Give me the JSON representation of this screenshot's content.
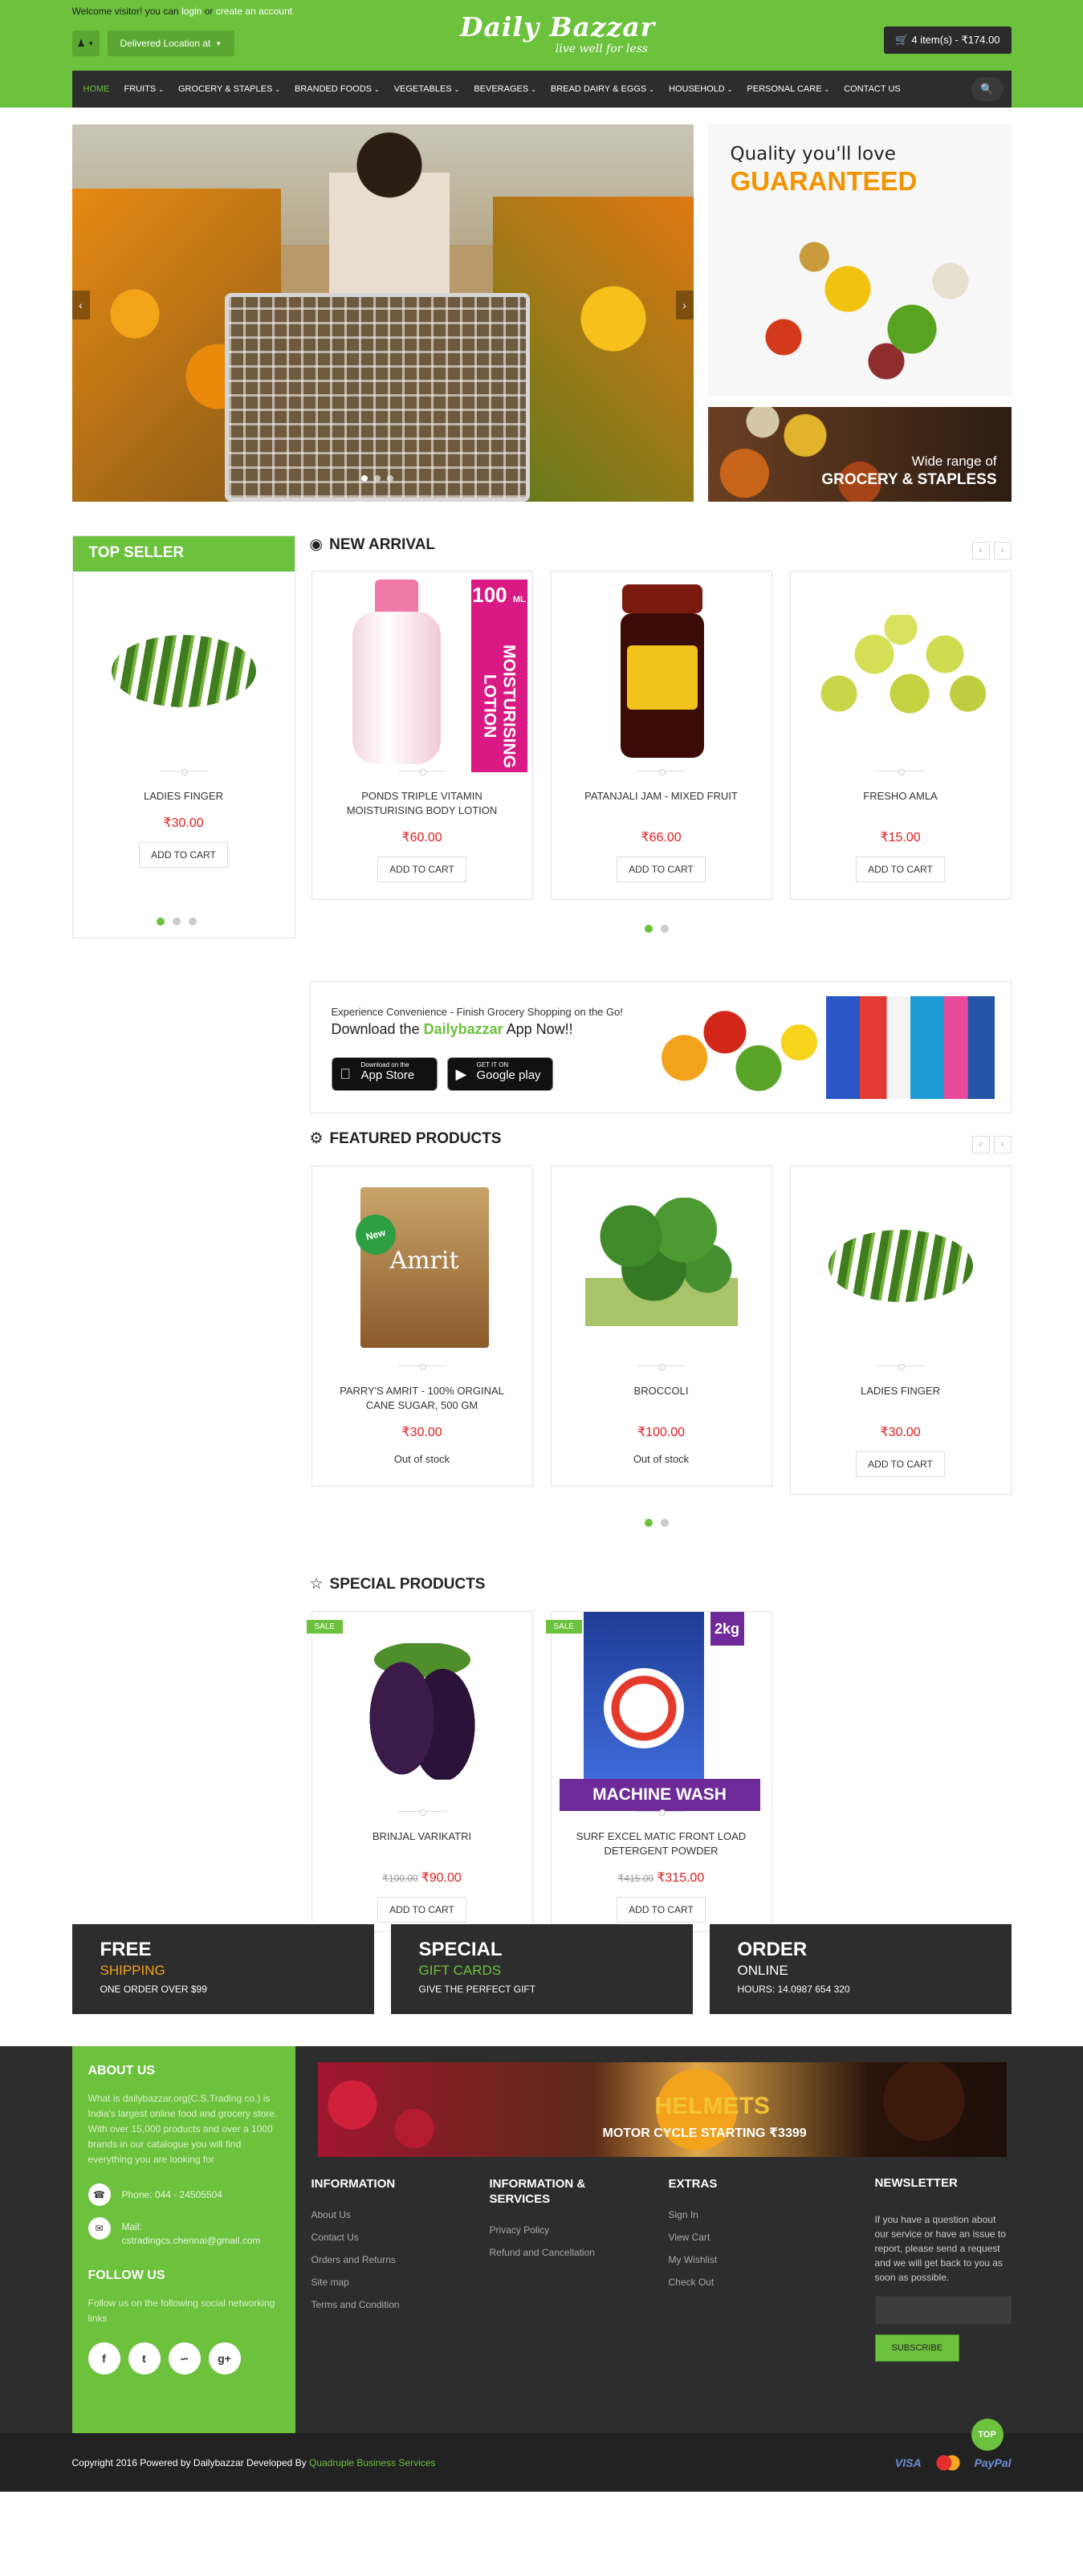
{
  "header": {
    "welcome_prefix": "Welcome visitor! you can ",
    "login": "login",
    "or": " or ",
    "create_account": "create an account",
    "location": "Delivered Location at",
    "logo_title": "Daily Bazzar",
    "logo_tagline": "live well for less",
    "cart": "4 item(s) - ₹174.00"
  },
  "nav": {
    "items": [
      {
        "label": "HOME"
      },
      {
        "label": "FRUITS"
      },
      {
        "label": "GROCERY & STAPLES"
      },
      {
        "label": "BRANDED FOODS"
      },
      {
        "label": "VEGETABLES"
      },
      {
        "label": "BEVERAGES"
      },
      {
        "label": "BREAD DAIRY & EGGS"
      },
      {
        "label": "HOUSEHOLD"
      },
      {
        "label": "PERSONAL CARE"
      },
      {
        "label": "CONTACT US"
      }
    ]
  },
  "banners": {
    "quality_line1": "Quality you'll love",
    "quality_line2": "GUARANTEED",
    "grocery_line1": "Wide range of",
    "grocery_line2": "GROCERY & STAPLESS"
  },
  "top_seller": {
    "title": "TOP SELLER",
    "product": {
      "name": "LADIES FINGER",
      "price": "₹30.00",
      "button": "ADD TO CART"
    }
  },
  "new_arrival": {
    "title": "NEW ARRIVAL",
    "products": [
      {
        "name": "PONDS TRIPLE VITAMIN MOISTURISING BODY LOTION",
        "price": "₹60.00",
        "button": "ADD TO CART",
        "img_num": "100",
        "img_unit": "ML",
        "img_text": "MOISTURISING LOTION"
      },
      {
        "name": "PATANJALI JAM - MIXED FRUIT",
        "price": "₹66.00",
        "button": "ADD TO CART"
      },
      {
        "name": "FRESHO AMLA",
        "price": "₹15.00",
        "button": "ADD TO CART"
      }
    ]
  },
  "app_banner": {
    "line1": "Experience Convenience - Finish Grocery Shopping on the Go!",
    "line2_pre": "Download the ",
    "line2_brand": "Dailybazzar",
    "line2_post": " App Now!!",
    "appstore_small": "Download on the",
    "appstore_big": "App Store",
    "gplay_small": "GET IT ON",
    "gplay_big": "Google play"
  },
  "featured": {
    "title": "FEATURED PRODUCTS",
    "products": [
      {
        "name": "PARRY'S AMRIT - 100% ORGINAL CANE SUGAR, 500 GM",
        "price": "₹30.00",
        "status": "Out of stock",
        "badge": "New",
        "img_text": "Amrit"
      },
      {
        "name": "BROCCOLI",
        "price": "₹100.00",
        "status": "Out of stock"
      },
      {
        "name": "LADIES FINGER",
        "price": "₹30.00",
        "button": "ADD TO CART"
      }
    ]
  },
  "special": {
    "title": "SPECIAL PRODUCTS",
    "products": [
      {
        "name": "BRINJAL VARIKATRI",
        "old_price": "₹100.00",
        "price": "₹90.00",
        "button": "ADD TO CART",
        "badge": "SALE"
      },
      {
        "name": "SURF EXCEL MATIC FRONT LOAD DETERGENT POWDER",
        "old_price": "₹415.00",
        "price": "₹315.00",
        "button": "ADD TO CART",
        "badge": "SALE",
        "img_kg": "2kg",
        "img_text": "MACHINE WASH"
      }
    ]
  },
  "features": [
    {
      "h": "FREE",
      "s": "SHIPPING",
      "d": "ONE ORDER OVER $99"
    },
    {
      "h": "SPECIAL",
      "s": "GIFT CARDS",
      "d": "GIVE THE PERFECT GIFT"
    },
    {
      "h": "ORDER",
      "s": "ONLINE",
      "d": "HOURS: 14.0987 654 320"
    }
  ],
  "footer": {
    "about_title": "ABOUT US",
    "about_text": "What is dailybazzar.org(C.S.Trading co.) is India's largest online food and grocery store. With over 15,000 products and over a 1000 brands in our catalogue you will find everything you are looking for",
    "phone": "Phone: 044 - 24505504",
    "mail": "Mail: cstradingcs.chennai@gmail.com",
    "follow_title": "FOLLOW US",
    "follow_text": "Follow us on the following social networking links",
    "banner_h": "HELMETS",
    "banner_m": "MOTOR CYCLE STARTING ₹3399",
    "col1_title": "INFORMATION",
    "col1": [
      {
        "label": "About Us"
      },
      {
        "label": "Contact Us"
      },
      {
        "label": "Orders and Returns"
      },
      {
        "label": "Site map"
      },
      {
        "label": "Terms and Condition"
      }
    ],
    "col2_title": "INFORMATION & SERVICES",
    "col2": [
      {
        "label": "Privacy Policy"
      },
      {
        "label": "Refund and Cancellation"
      }
    ],
    "col3_title": "EXTRAS",
    "col3": [
      {
        "label": "Sign In"
      },
      {
        "label": "View Cart"
      },
      {
        "label": "My Wishlist"
      },
      {
        "label": "Check Out"
      }
    ],
    "nl_title": "NEWSLETTER",
    "nl_text": "If you have a question about our service or have an issue to report, please send a request and we will get back to you as soon as possible.",
    "nl_button": "SUBSCRIBE",
    "totop": "TOP"
  },
  "bottom": {
    "copy": "Copyright 2016 Powered by Dailybazzar Developed By ",
    "dev": "Quadruple Business Services",
    "visa": "VISA",
    "paypal": "PayPal"
  },
  "colors": {
    "brand": "#6cc13d",
    "dark": "#2d2d2d",
    "price": "#e02020",
    "accent": "#f29400"
  }
}
